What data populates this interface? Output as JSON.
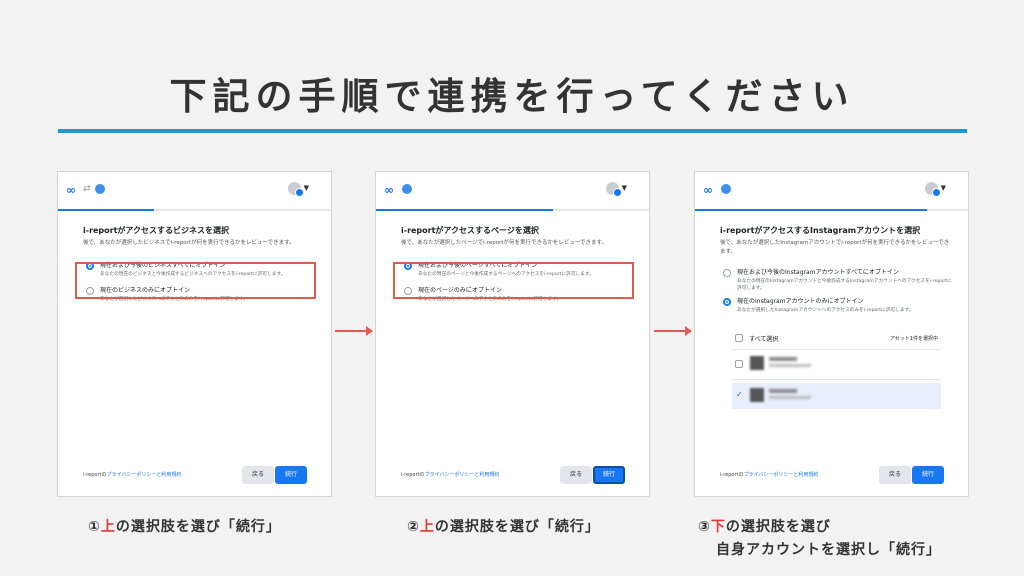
{
  "title": "下記の手順で連携を行ってください",
  "common": {
    "meta_logo": "∞",
    "sync_icon": "⇄",
    "footer_prefix": "i-reportの",
    "footer_link": "プライバシーポリシーと利用規約",
    "back_label": "戻る",
    "next_label": "続行"
  },
  "panel1": {
    "heading": "i-reportがアクセスするビジネスを選択",
    "sub": "後で、あなたが選択したビジネスでi-reportが何を実行できるかをレビューできます。",
    "opt1_title": "現在および今後のビジネスすべてにオプトイン",
    "opt1_desc": "あなたの現在のビジネスと今後作成するビジネスへのアクセスをi-reportに許可します。",
    "opt2_title": "現在のビジネスのみにオプトイン",
    "opt2_desc": "あなたが選択したビジネスへのアクセスのみをi-reportに許可します。"
  },
  "panel2": {
    "heading": "i-reportがアクセスするページを選択",
    "sub": "後で、あなたが選択したページでi-reportが何を実行できるかをレビューできます。",
    "opt1_title": "現在および今後のページすべてにオプトイン",
    "opt1_desc": "あなたの現在のページと今後作成するページへのアクセスをi-reportに許可します。",
    "opt2_title": "現在のページのみにオプトイン",
    "opt2_desc": "あなたが選択したページへのアクセスのみをi-reportに許可します。"
  },
  "panel3": {
    "heading": "i-reportがアクセスするInstagramアカウントを選択",
    "sub": "後で、あなたが選択したInstagramアカウントでi-reportが何を実行できるかをレビューできます。",
    "opt1_title": "現在および今後のInstagramアカウントすべてにオプトイン",
    "opt1_desc": "あなたの現在のInstagramアカウントと今後作成するInstagramアカウントへのアクセスをi-reportに許可します。",
    "opt2_title": "現在のInstagramアカウントのみにオプトイン",
    "opt2_desc": "あなたが選択したInstagramアカウントへのアクセスのみをi-reportに許可します。",
    "select_all": "すべて選択",
    "selected_count": "アセット1件を選択中"
  },
  "captions": {
    "c1_num": "①",
    "c1_red": "上",
    "c1_rest": "の選択肢を選び「続行」",
    "c2_num": "②",
    "c2_red": "上",
    "c2_rest": "の選択肢を選び「続行」",
    "c3_num": "③",
    "c3_red": "下",
    "c3_rest": "の選択肢を選び",
    "c3_line2": "自身アカウントを選択し「続行」"
  },
  "colors": {
    "accent": "#1877f2",
    "highlight": "#e05a50",
    "title_line": "#1f97d6",
    "caption_red": "#e03a2f"
  },
  "progress": {
    "panel1": 0.35,
    "panel2": 0.65,
    "panel3": 0.85
  }
}
